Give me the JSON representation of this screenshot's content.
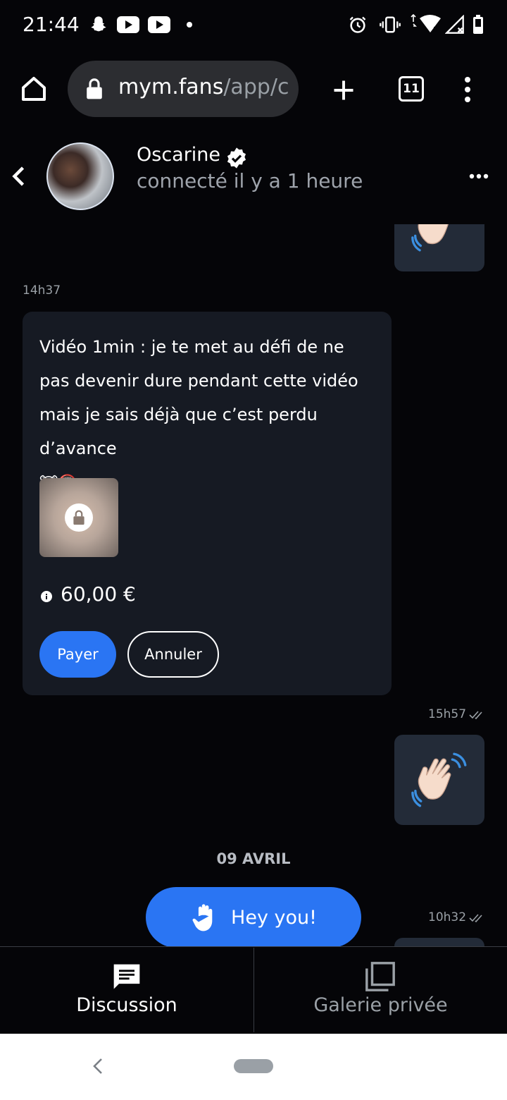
{
  "status_bar": {
    "time": "21:44",
    "icons": [
      "snapchat-icon",
      "youtube-icon",
      "youtube-icon",
      "dot-icon",
      "alarm-icon",
      "vibrate-icon",
      "wifi-icon",
      "signal-icon",
      "battery-icon"
    ],
    "wifi_badge": "5"
  },
  "browser": {
    "url_host": "mym.fans",
    "url_path": "/app/c",
    "tab_count": "11"
  },
  "chat_header": {
    "name": "Oscarine",
    "presence": "connecté il y a 1 heure"
  },
  "messages": {
    "time_1": "14h37",
    "offer_text": "Vidéo 1min : je te met au défi de ne pas devenir dure pendant cette vidéo mais je sais déjà que c’est perdu d’avance",
    "offer_emojis": "🐮🔞",
    "price": "60,00 €",
    "pay_label": "Payer",
    "cancel_label": "Annuler",
    "time_2": "15h57",
    "date_separator": "09 AVRIL",
    "time_3": "10h32",
    "hey_label": "Hey you!"
  },
  "tabs": [
    {
      "label": "Discussion",
      "active": true
    },
    {
      "label": "Galerie privée",
      "active": false
    }
  ],
  "colors": {
    "accent": "#2a75f3",
    "background": "#050508",
    "bubble_out": "#232b38",
    "card": "#161a23"
  }
}
